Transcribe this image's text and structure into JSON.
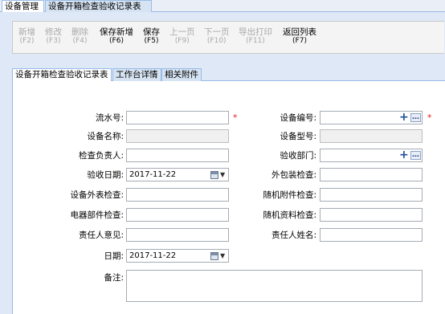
{
  "top_tabs": [
    "设备管理",
    "设备开箱检查验收记录表"
  ],
  "toolbar": {
    "buttons": [
      {
        "label": "新增",
        "key": "(F2)",
        "enabled": false
      },
      {
        "label": "修改",
        "key": "(F3)",
        "enabled": false
      },
      {
        "label": "删除",
        "key": "(F4)",
        "enabled": false
      },
      {
        "label": "保存新增",
        "key": "(F6)",
        "enabled": true
      },
      {
        "label": "保存",
        "key": "(F5)",
        "enabled": true
      },
      {
        "label": "上一页",
        "key": "(F9)",
        "enabled": false
      },
      {
        "label": "下一页",
        "key": "(F10)",
        "enabled": false
      },
      {
        "label": "导出打印",
        "key": "(F11)",
        "enabled": false
      },
      {
        "label": "返回列表",
        "key": "(F7)",
        "enabled": true
      }
    ]
  },
  "sub_tabs": [
    "设备开箱检查验收记录表",
    "工作台详情",
    "相关附件"
  ],
  "form": {
    "serial_no_label": "流水号:",
    "serial_no_value": "",
    "device_no_label": "设备编号:",
    "device_no_value": "",
    "device_name_label": "设备名称:",
    "device_name_value": "",
    "device_model_label": "设备型号:",
    "device_model_value": "",
    "inspector_label": "检查负责人:",
    "inspector_value": "",
    "dept_label": "验收部门:",
    "dept_value": "",
    "accept_date_label": "验收日期:",
    "accept_date_value": "2017-11-22",
    "package_label": "外包装检查:",
    "package_value": "",
    "appearance_label": "设备外表检查:",
    "appearance_value": "",
    "accessory_label": "随机附件检查:",
    "accessory_value": "",
    "electrical_label": "电器部件检查:",
    "electrical_value": "",
    "docs_label": "随机资料检查:",
    "docs_value": "",
    "opinion_label": "责任人意见:",
    "opinion_value": "",
    "person_name_label": "责任人姓名:",
    "person_name_value": "",
    "date_label": "日期:",
    "date_value": "2017-11-22",
    "remark_label": "备注:",
    "remark_value": "",
    "required_mark": "*"
  },
  "colors": {
    "tab_border": "#99bbe8",
    "panel_bg": "#dfe8f6",
    "required": "#e02020",
    "disabled_text": "#a8a8a8"
  }
}
